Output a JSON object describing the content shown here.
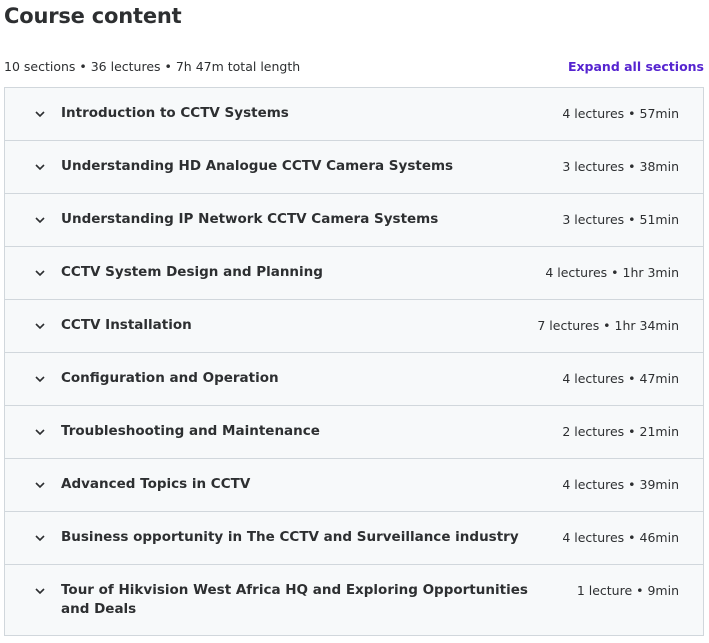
{
  "header": {
    "title": "Course content",
    "summary": "10 sections • 36 lectures • 7h 47m total length",
    "expand_label": "Expand all sections"
  },
  "sections": [
    {
      "title": "Introduction to CCTV Systems",
      "info": "4 lectures • 57min"
    },
    {
      "title": "Understanding HD Analogue CCTV Camera Systems",
      "info": "3 lectures • 38min"
    },
    {
      "title": "Understanding IP Network CCTV Camera Systems",
      "info": "3 lectures • 51min"
    },
    {
      "title": "CCTV System Design and Planning",
      "info": "4 lectures • 1hr 3min"
    },
    {
      "title": "CCTV Installation",
      "info": "7 lectures • 1hr 34min"
    },
    {
      "title": "Configuration and Operation",
      "info": "4 lectures • 47min"
    },
    {
      "title": "Troubleshooting and Maintenance",
      "info": "2 lectures • 21min"
    },
    {
      "title": "Advanced Topics in CCTV",
      "info": "4 lectures • 39min"
    },
    {
      "title": "Business opportunity in The CCTV and Surveillance industry",
      "info": "4 lectures • 46min"
    },
    {
      "title": "Tour of Hikvision West Africa HQ and Exploring Opportunities and Deals",
      "info": "1 lecture • 9min"
    }
  ],
  "icons": {
    "section_toggle": "chevron-down-icon"
  },
  "colors": {
    "accent": "#5624d0",
    "row_bg": "#f7f9fa",
    "border": "#d1d7dc",
    "text": "#2d2f31"
  }
}
